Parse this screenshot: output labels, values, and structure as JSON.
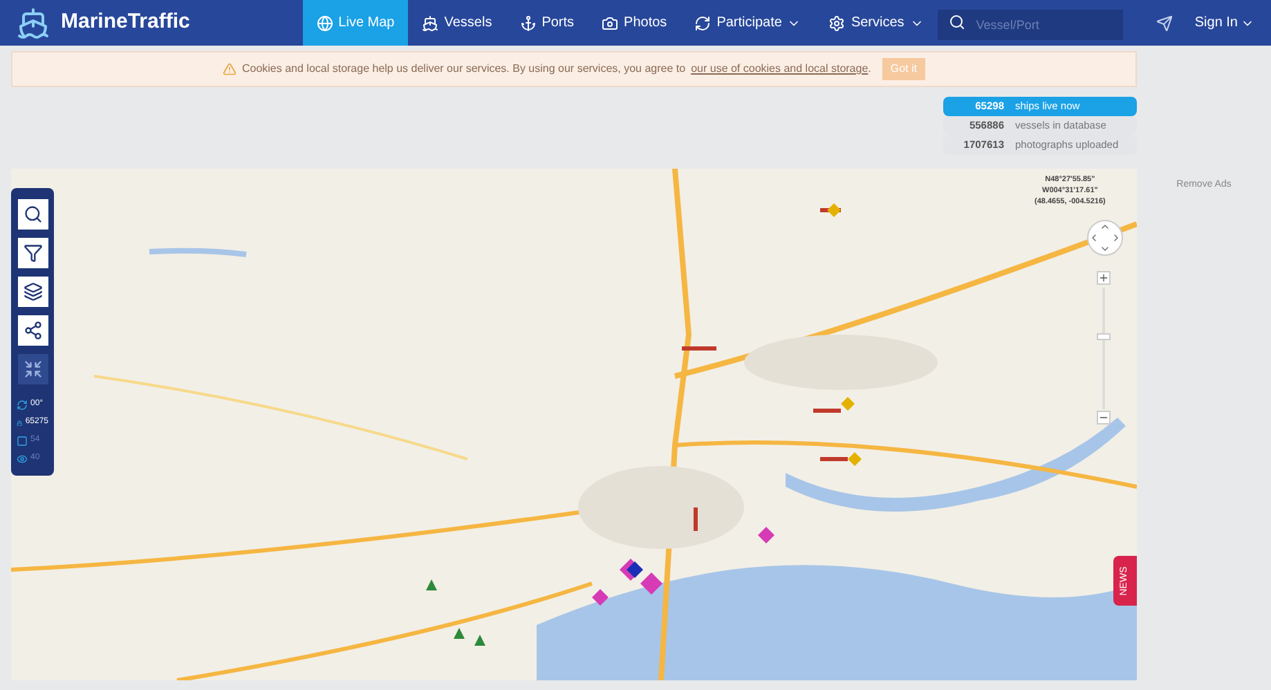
{
  "brand": "MarineTraffic",
  "nav": [
    {
      "label": "Live Map",
      "kind": "link",
      "selected": true
    },
    {
      "label": "Vessels",
      "kind": "link",
      "selected": false
    },
    {
      "label": "Ports",
      "kind": "link",
      "selected": false
    },
    {
      "label": "Photos",
      "kind": "link",
      "selected": false
    },
    {
      "label": "Participate",
      "kind": "dropdown",
      "selected": false
    },
    {
      "label": "Services",
      "kind": "dropdown",
      "selected": false
    }
  ],
  "search": {
    "placeholder": "Vessel/Port"
  },
  "sign_in": "Sign In",
  "cookie": {
    "text": "Cookies and local storage help us deliver our services. By using our services, you agree to",
    "link": "our use of cookies and local storage",
    "end": ".",
    "button": "Got it"
  },
  "stats": [
    {
      "value": "65298",
      "label": "ships live now",
      "selected": true
    },
    {
      "value": "556886",
      "label": "vessels in database",
      "selected": false
    },
    {
      "value": "1707613",
      "label": "photographs uploaded",
      "selected": false
    }
  ],
  "remove_ads": "Remove Ads",
  "coordinates": [
    "N48°27'55.85\"",
    "W004°31'17.61\"",
    "(48.4655, -004.5216)"
  ],
  "counters": [
    "00°",
    "65275",
    "54",
    "40"
  ],
  "news": "NEWS"
}
